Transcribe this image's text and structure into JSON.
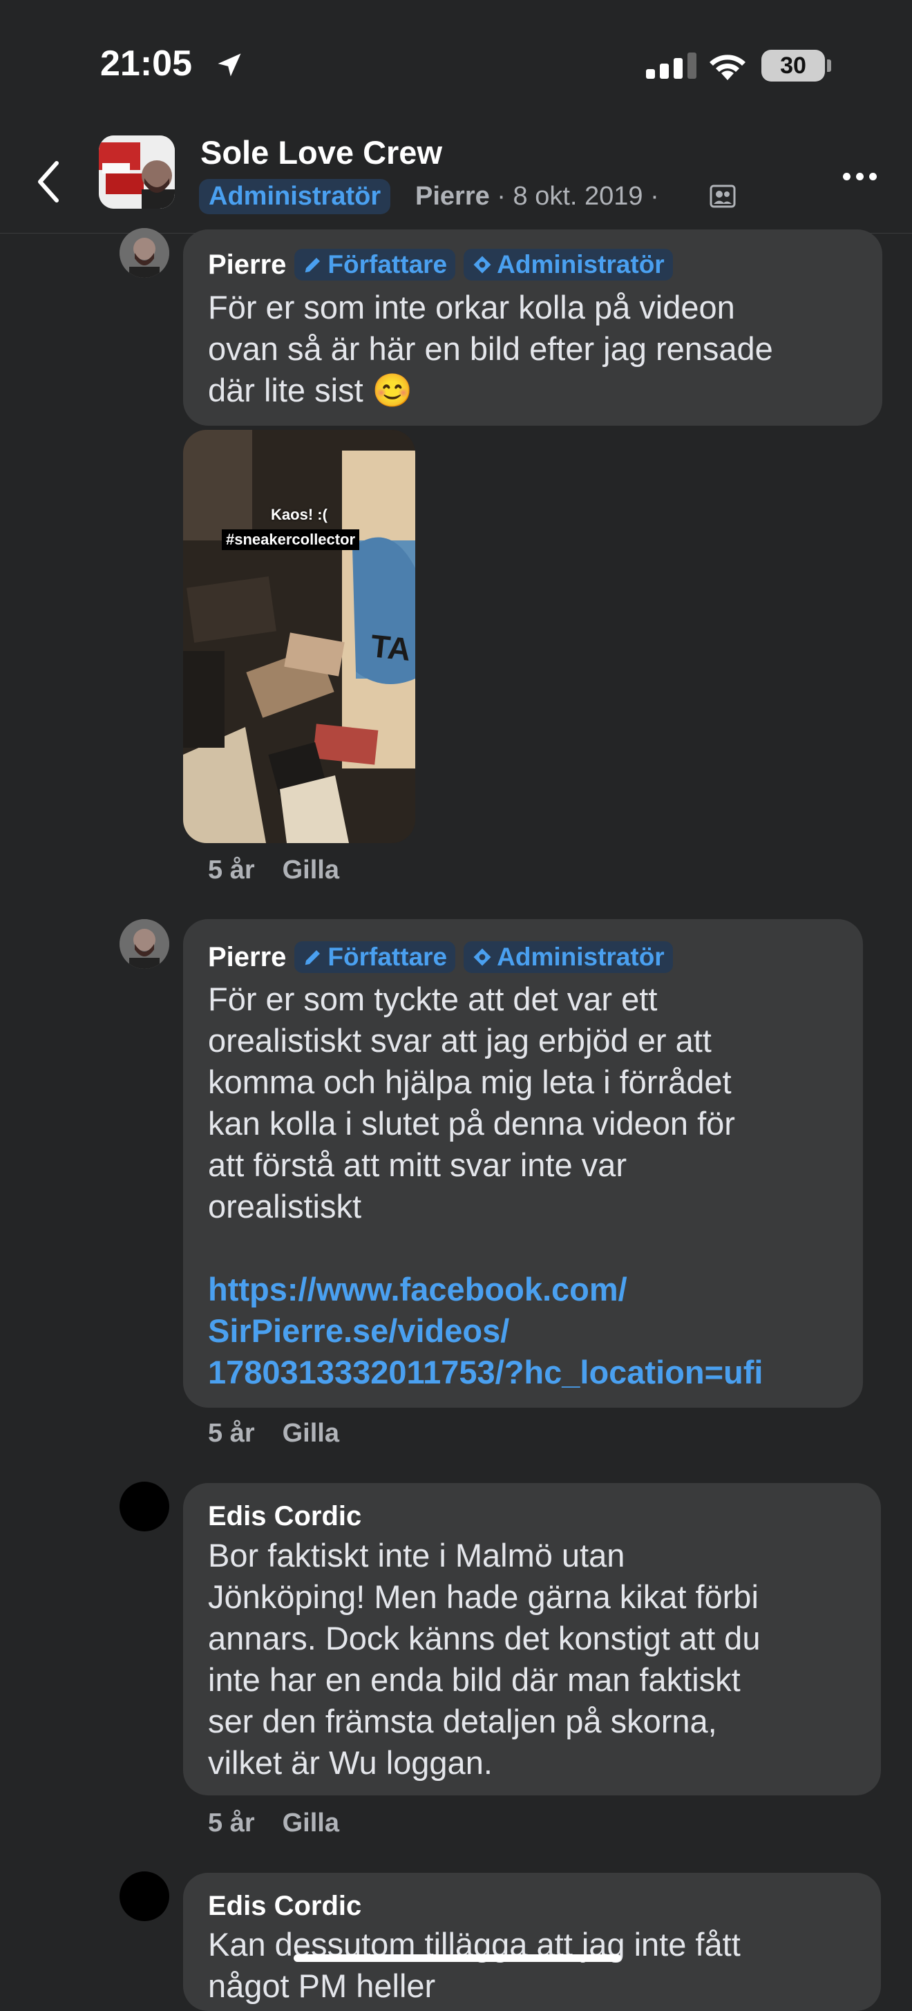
{
  "status": {
    "time": "21:05",
    "battery": "30"
  },
  "header": {
    "group_name": "Sole Love Crew",
    "role_badge": "Administratör",
    "author": "Pierre",
    "date": " · 8 okt. 2019 · "
  },
  "comments": [
    {
      "author": "Pierre",
      "badges": [
        "Författare",
        "Administratör"
      ],
      "text": "För er som inte orkar kolla på videon\novan så är här en bild efter jag rensade\ndär lite sist 😊",
      "image_caption_line1": "Kaos! :(",
      "image_caption_line2": "#sneakercollector",
      "time": "5 år",
      "like": "Gilla"
    },
    {
      "author": "Pierre",
      "badges": [
        "Författare",
        "Administratör"
      ],
      "text": "För er som tyckte att det var ett\norealistiskt svar att jag erbjöd er att\nkomma och hjälpa mig leta i förrådet\nkan kolla i slutet på denna videon för\natt förstå att mitt svar inte var\norealistiskt",
      "link": "https://www.facebook.com/\nSirPierre.se/videos/\n1780313332011753/?hc_location=ufi",
      "time": "5 år",
      "like": "Gilla"
    },
    {
      "author": "Edis Cordic",
      "text": "Bor faktiskt inte i Malmö utan\nJönköping! Men hade gärna kikat förbi\nannars. Dock känns det konstigt att du\ninte har en enda bild där man faktiskt\nser den främsta detaljen på skorna,\nvilket är Wu loggan.",
      "time": "5 år",
      "like": "Gilla"
    },
    {
      "author": "Edis Cordic",
      "text": "Kan dessutom tillägga att jag inte fått\nnågot PM heller"
    }
  ]
}
